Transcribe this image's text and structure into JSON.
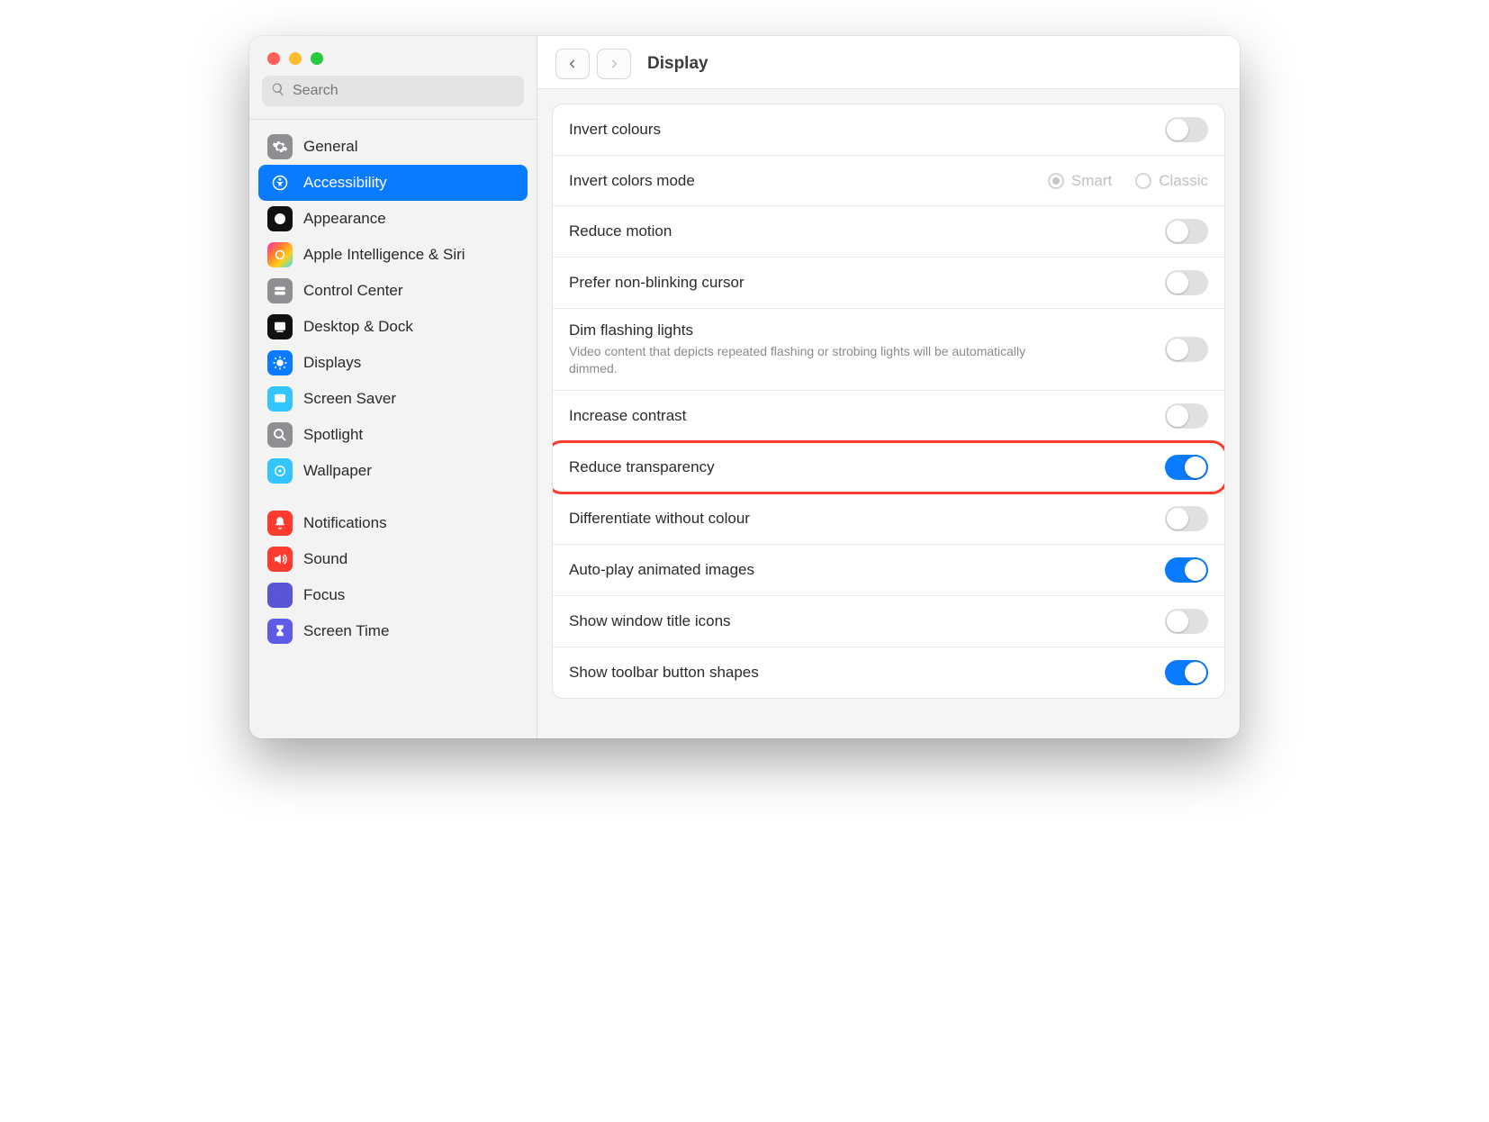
{
  "header": {
    "title": "Display"
  },
  "search": {
    "placeholder": "Search"
  },
  "sidebar": {
    "group1": [
      {
        "key": "general",
        "label": "General"
      },
      {
        "key": "accessibility",
        "label": "Accessibility"
      },
      {
        "key": "appearance",
        "label": "Appearance"
      },
      {
        "key": "ai-siri",
        "label": "Apple Intelligence & Siri"
      },
      {
        "key": "control-center",
        "label": "Control Center"
      },
      {
        "key": "desktop-dock",
        "label": "Desktop & Dock"
      },
      {
        "key": "displays",
        "label": "Displays"
      },
      {
        "key": "screen-saver",
        "label": "Screen Saver"
      },
      {
        "key": "spotlight",
        "label": "Spotlight"
      },
      {
        "key": "wallpaper",
        "label": "Wallpaper"
      }
    ],
    "group2": [
      {
        "key": "notifications",
        "label": "Notifications"
      },
      {
        "key": "sound",
        "label": "Sound"
      },
      {
        "key": "focus",
        "label": "Focus"
      },
      {
        "key": "screen-time",
        "label": "Screen Time"
      }
    ]
  },
  "settings": {
    "invert_colours": {
      "label": "Invert colours",
      "on": false
    },
    "invert_mode": {
      "label": "Invert colors mode",
      "options": [
        "Smart",
        "Classic"
      ],
      "selected": "Smart"
    },
    "reduce_motion": {
      "label": "Reduce motion",
      "on": false
    },
    "prefer_non_blinking": {
      "label": "Prefer non-blinking cursor",
      "on": false
    },
    "dim_flashing": {
      "label": "Dim flashing lights",
      "sub": "Video content that depicts repeated flashing or strobing lights will be automatically dimmed.",
      "on": false
    },
    "increase_contrast": {
      "label": "Increase contrast",
      "on": false
    },
    "reduce_transparency": {
      "label": "Reduce transparency",
      "on": true,
      "highlight": true
    },
    "differentiate_colour": {
      "label": "Differentiate without colour",
      "on": false
    },
    "autoplay_images": {
      "label": "Auto-play animated images",
      "on": true
    },
    "show_title_icons": {
      "label": "Show window title icons",
      "on": false
    },
    "show_toolbar_shapes": {
      "label": "Show toolbar button shapes",
      "on": true
    }
  }
}
